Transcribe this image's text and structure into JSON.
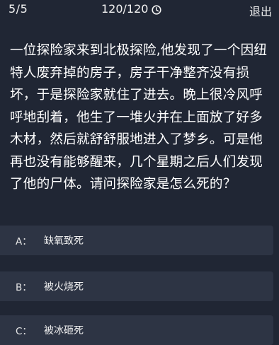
{
  "header": {
    "progress": "5/5",
    "timer": "120/120",
    "timer_icon": "clock-icon",
    "exit_label": "退出"
  },
  "question": {
    "text": "一位探险家来到北极探险,他发现了一个因纽特人废弃掉的房子，房子干净整齐没有损坏，于是探险家就住了进去。晚上很冷风呼呼地刮着，他生了一堆火并在上面放了好多木材，然后就舒舒服地进入了梦乡。可是他再也没有能够醒来，几个星期之后人们发现了他的尸体。请问探险家是怎么死的？"
  },
  "options": [
    {
      "letter": "A：",
      "text": "缺氧致死"
    },
    {
      "letter": "B：",
      "text": "被火烧死"
    },
    {
      "letter": "C：",
      "text": "被冰砸死"
    }
  ],
  "colors": {
    "background": "#202634",
    "option_background": "#2d3444",
    "text": "#ffffff"
  }
}
